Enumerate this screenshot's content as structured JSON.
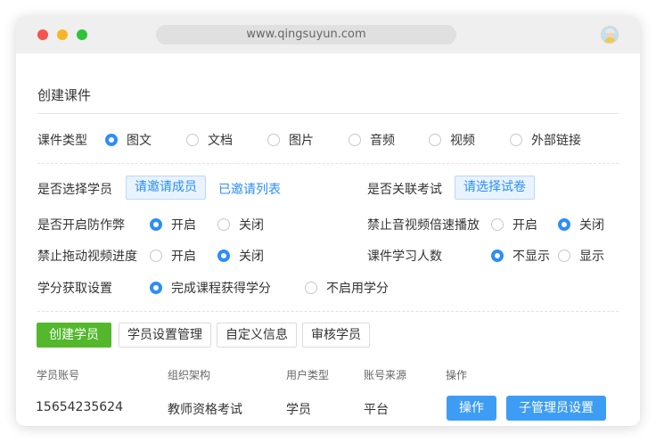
{
  "browser": {
    "url": "www.qingsuyun.com"
  },
  "page": {
    "title": "创建课件"
  },
  "courseware_type": {
    "label": "课件类型",
    "options": [
      "图文",
      "文档",
      "图片",
      "音频",
      "视频",
      "外部链接"
    ],
    "selected": "图文"
  },
  "select_students": {
    "label": "是否选择学员",
    "invite_button": "请邀请成员",
    "invited_list_link": "已邀请列表"
  },
  "link_exam": {
    "label": "是否关联考试",
    "select_button": "请选择试卷"
  },
  "anti_cheat": {
    "label": "是否开启防作弊",
    "options": [
      "开启",
      "关闭"
    ],
    "selected": "开启"
  },
  "disable_speed": {
    "label": "禁止音视频倍速播放",
    "options": [
      "开启",
      "关闭"
    ],
    "selected": "关闭"
  },
  "disable_drag": {
    "label": "禁止拖动视频进度",
    "options": [
      "开启",
      "关闭"
    ],
    "selected": "关闭"
  },
  "learner_count": {
    "label": "课件学习人数",
    "options": [
      "不显示",
      "显示"
    ],
    "selected": "不显示"
  },
  "credit": {
    "label": "学分获取设置",
    "options": [
      "完成课程获得学分",
      "不启用学分"
    ],
    "selected": "完成课程获得学分"
  },
  "toolbar": {
    "create_student": "创建学员",
    "student_settings": "学员设置管理",
    "custom_info": "自定义信息",
    "review_student": "审核学员"
  },
  "table": {
    "columns": [
      "学员账号",
      "组织架构",
      "用户类型",
      "账号来源",
      "操作"
    ],
    "rows": [
      {
        "account": "15654235624",
        "org": "教师资格考试",
        "user_type": "学员",
        "source": "平台",
        "action_button": "操作",
        "sub_admin_button": "子管理员设置"
      }
    ]
  },
  "colors": {
    "primary": "#2c8ef8",
    "green": "#53b82c",
    "action_blue": "#3d9df5"
  }
}
